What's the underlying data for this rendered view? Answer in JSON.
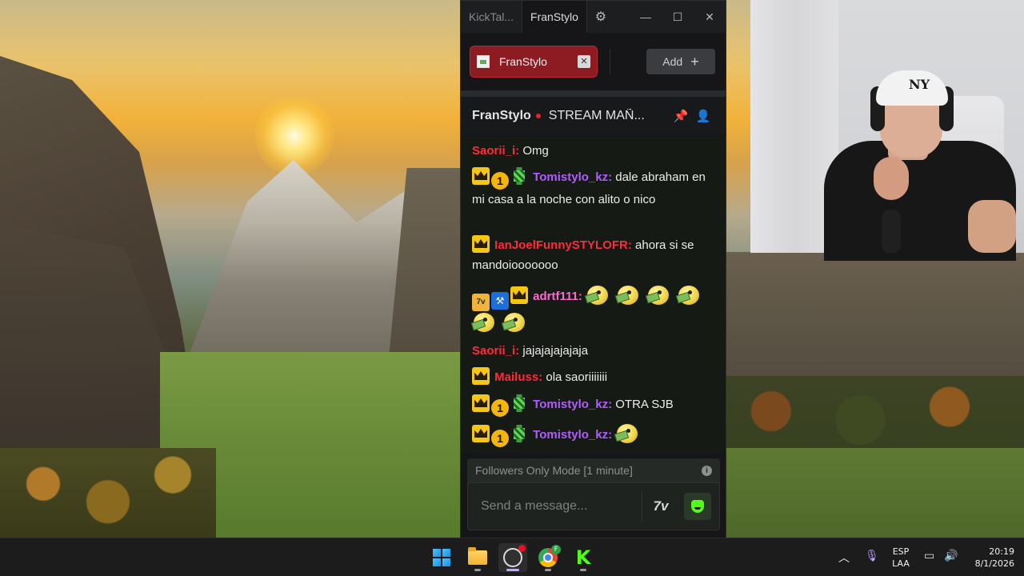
{
  "app": {
    "tabs": [
      "KickTal...",
      "FranStylo"
    ],
    "window_controls": [
      "minimize",
      "maximize",
      "close"
    ]
  },
  "channel_tabs": {
    "active": "FranStylo",
    "add_label": "Add"
  },
  "chat_header": {
    "channel": "FranStylo",
    "title": "STREAM MAÑ..."
  },
  "messages": [
    {
      "user": "Saorii_i:",
      "color": "red",
      "badges": [],
      "text": "Omg"
    },
    {
      "user": "Tomistylo_kz:",
      "color": "purple",
      "badges": [
        "crown",
        "one",
        "pixel"
      ],
      "text": "dale abraham en mi casa a la noche con alito o nico"
    },
    {
      "user": "IanJoelFunnySTYLOFR:",
      "color": "red",
      "badges": [
        "crown"
      ],
      "text": "ahora si se mandoiooooooo"
    },
    {
      "user": "adrtf111:",
      "color": "pink",
      "badges": [
        "7tv",
        "hammer",
        "crown"
      ],
      "text": "",
      "emotes": 6
    },
    {
      "user": "Saorii_i:",
      "color": "red",
      "badges": [],
      "text": "jajajajajajaja"
    },
    {
      "user": "Mailuss:",
      "color": "red",
      "badges": [
        "crown"
      ],
      "text": "ola saoriiiiiii"
    },
    {
      "user": "Tomistylo_kz:",
      "color": "purple",
      "badges": [
        "crown",
        "one",
        "pixel"
      ],
      "text": "OTRA SJB"
    },
    {
      "user": "Tomistylo_kz:",
      "color": "purple",
      "badges": [
        "crown",
        "one",
        "pixel"
      ],
      "text": "",
      "emotes": 1
    }
  ],
  "badge_one_text": "1",
  "badge_7tv_text": "7v",
  "input": {
    "mode_notice": "Followers Only Mode [1 minute]",
    "placeholder": "Send a message...",
    "seven_tv": "7v"
  },
  "taskbar": {
    "apps": [
      "windows-start",
      "file-explorer",
      "obs-studio",
      "chrome",
      "kick"
    ],
    "chrome_profile": "F",
    "language": "ESP",
    "layout": "LAA",
    "time": "20:19",
    "date": "8/1/2026"
  },
  "webcam": {
    "hat_logo": "NY"
  },
  "colors": {
    "kick_green": "#53fc18",
    "live_red": "#e02434",
    "username_red": "#ff2a3d",
    "username_purple": "#b15cff",
    "username_pink": "#ff68d0"
  }
}
